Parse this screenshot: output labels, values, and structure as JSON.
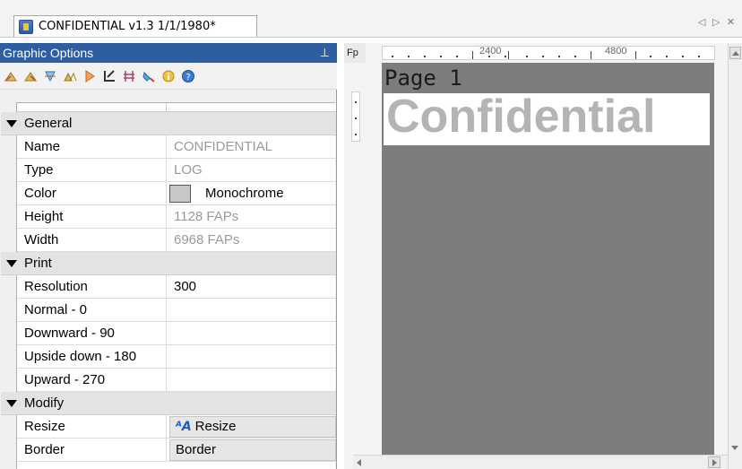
{
  "tab": {
    "title": "CONFIDENTIAL v1.3 1/1/1980*",
    "scroll_arrows": "◁ ▷ ✕"
  },
  "panel": {
    "title": "Graphic Options",
    "pin_glyph": "⊥",
    "toolbar_icons": [
      "rotate-left-icon",
      "rotate-right-icon",
      "flip-icon",
      "mirror-icon",
      "triangle-icon",
      "crop-icon",
      "adjust-icon",
      "color-picker-icon",
      "info-icon",
      "help-icon"
    ]
  },
  "properties": {
    "general": {
      "category": "General",
      "name_label": "Name",
      "name_value": "CONFIDENTIAL",
      "type_label": "Type",
      "type_value": "LOG",
      "color_label": "Color",
      "color_value": "Monochrome",
      "height_label": "Height",
      "height_value": "1128 FAPs",
      "width_label": "Width",
      "width_value": "6968 FAPs"
    },
    "print": {
      "category": "Print",
      "resolution_label": "Resolution",
      "resolution_value": "300",
      "normal_label": "Normal - 0",
      "downward_label": "Downward - 90",
      "upside_label": "Upside down - 180",
      "upward_label": "Upward - 270"
    },
    "modify": {
      "category": "Modify",
      "resize_label": "Resize",
      "resize_button": "Resize",
      "resize_icon_text": "ᴬA",
      "border_label": "Border",
      "border_button": "Border"
    }
  },
  "preview": {
    "ruler_corner": "Fp",
    "ruler_labels": [
      "2400",
      "4800"
    ],
    "page_label": "Page 1",
    "watermark": "Confidential"
  },
  "colors": {
    "title_bar": "#2e5da0",
    "canvas_gray": "#7d7d7d",
    "watermark_text": "#b4b4b4"
  }
}
